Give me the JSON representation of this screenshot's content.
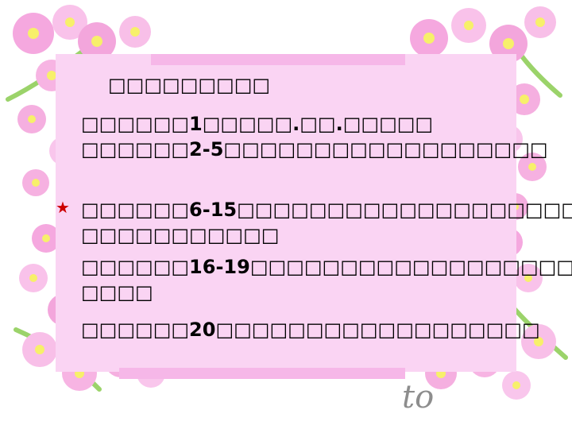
{
  "slide": {
    "title": "□□□□□□□□□",
    "lines": [
      "□□□□□□1□□□□□.□□.□□□□□",
      "□□□□□□2-5□□□□□□□□□□□□□□□□□□",
      "□□□□□□6-15□□□□□□□□□□□□□□□□□□□□",
      "□□□□□□□□□□□",
      "□□□□□□16-19□□□□□□□□□□□□□□□□□□□",
      "□□□□",
      "□□□□□□20□□□□□□□□□□□□□□□□□□"
    ],
    "star_glyph": "★",
    "watermark": "to"
  }
}
